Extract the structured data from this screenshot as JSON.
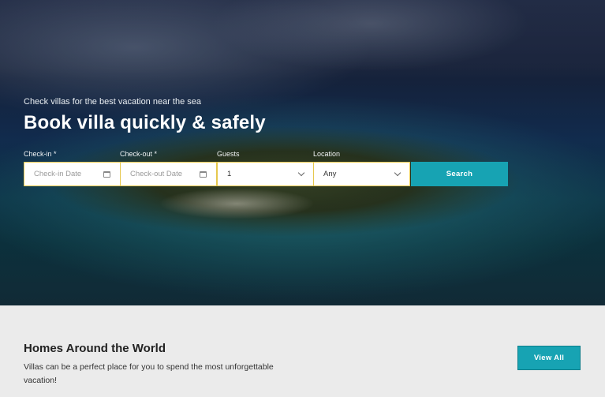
{
  "hero": {
    "subtitle": "Check villas for the best vacation near the sea",
    "title": "Book villa quickly & safely"
  },
  "search_form": {
    "check_in": {
      "label": "Check-in *",
      "placeholder": "Check-in Date",
      "icon": "calendar-icon"
    },
    "check_out": {
      "label": "Check-out *",
      "placeholder": "Check-out Date",
      "icon": "calendar-icon"
    },
    "guests": {
      "label": "Guests",
      "value": "1",
      "icon": "chevron-down-icon"
    },
    "location": {
      "label": "Location",
      "value": "Any",
      "icon": "chevron-down-icon"
    },
    "search_label": "Search"
  },
  "homes_section": {
    "title": "Homes Around the World",
    "description": "Villas can be a perfect place for you to spend the most unforgettable vacation!",
    "view_all_label": "View All"
  },
  "colors": {
    "accent": "#17a3b3",
    "field_border": "#e6c84e",
    "section_bg": "#ebebeb"
  }
}
